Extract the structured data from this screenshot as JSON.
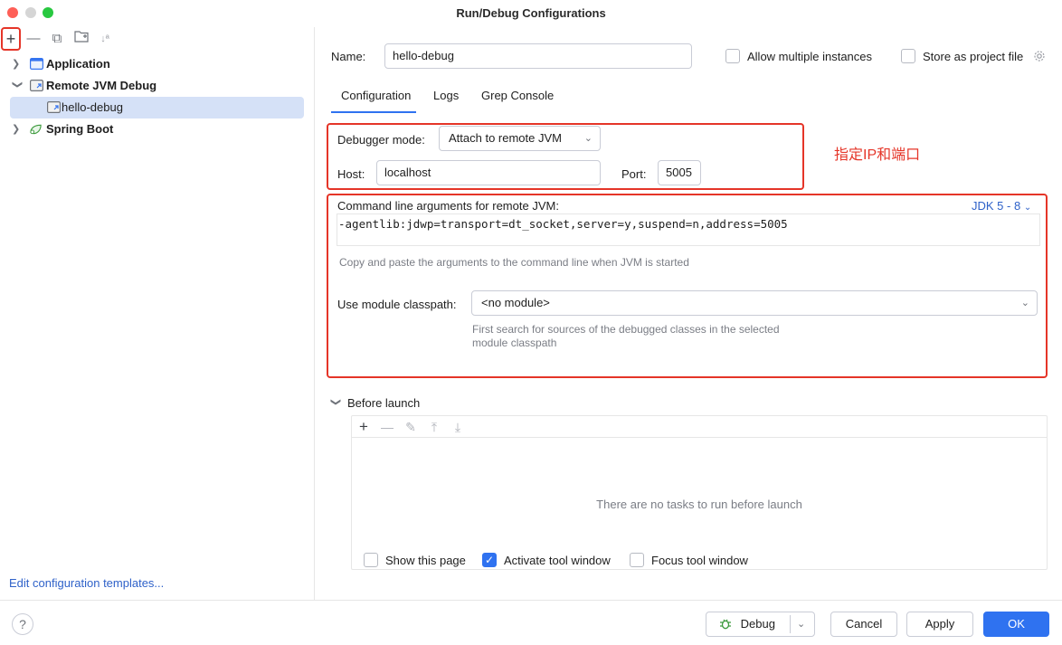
{
  "window": {
    "title": "Run/Debug Configurations"
  },
  "sidebar": {
    "toolbar": {
      "add": "+",
      "remove": "—",
      "copy": "⧉",
      "folder": "🗀",
      "sort": "↓ª"
    },
    "tree": [
      {
        "label": "Application",
        "icon": "application-icon",
        "expanded": false
      },
      {
        "label": "Remote JVM Debug",
        "icon": "remote-jvm-debug-icon",
        "expanded": true
      },
      {
        "label": "hello-debug",
        "icon": "remote-debug-config-icon",
        "selected": true
      },
      {
        "label": "Spring Boot",
        "icon": "spring-boot-icon",
        "expanded": false
      }
    ],
    "edit_templates": "Edit configuration templates..."
  },
  "main": {
    "name_label": "Name:",
    "name_value": "hello-debug",
    "allow_multiple": "Allow multiple instances",
    "store_project": "Store as project file",
    "tabs": [
      {
        "label": "Configuration",
        "active": true
      },
      {
        "label": "Logs"
      },
      {
        "label": "Grep Console"
      }
    ],
    "debugger_mode_label": "Debugger mode:",
    "debugger_mode_value": "Attach to remote JVM",
    "host_label": "Host:",
    "host_value": "localhost",
    "port_label": "Port:",
    "port_value": "5005",
    "annotation": "指定IP和端口",
    "cmd_label": "Command line arguments for remote JVM:",
    "jdk_selector": "JDK 5 - 8",
    "cmd_value": "-agentlib:jdwp=transport=dt_socket,server=y,suspend=n,address=5005",
    "cmd_hint": "Copy and paste the arguments to the command line when JVM is started",
    "module_label": "Use module classpath:",
    "module_value": "<no module>",
    "module_hint_1": "First search for sources of the debugged classes in the selected",
    "module_hint_2": "module classpath",
    "before_launch": "Before launch",
    "no_tasks": "There are no tasks to run before launch",
    "show_page": "Show this page",
    "activate_tool": "Activate tool window",
    "focus_tool": "Focus tool window"
  },
  "footer": {
    "help": "?",
    "debug": "Debug",
    "cancel": "Cancel",
    "apply": "Apply",
    "ok": "OK"
  },
  "colors": {
    "accent": "#2f72f0",
    "annotation_red": "#e53528",
    "selection": "#d5e1f7"
  }
}
